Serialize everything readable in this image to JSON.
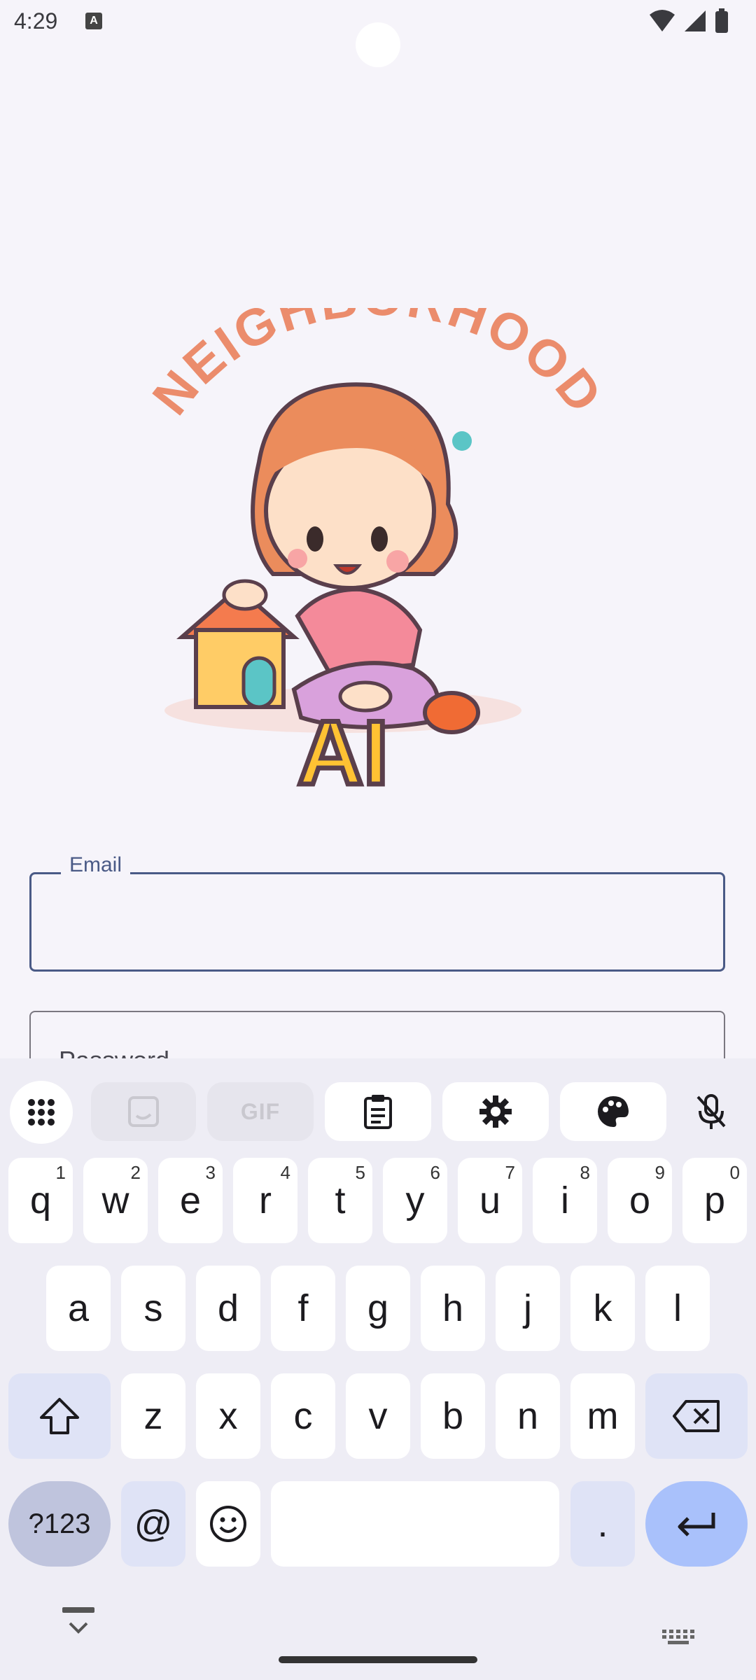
{
  "status_bar": {
    "time": "4:29",
    "notification_icon": "A"
  },
  "app": {
    "logo": {
      "arc_text": "NEIGHBORHOOD",
      "text_bottom": "AI"
    },
    "email": {
      "label": "Email",
      "value": ""
    },
    "password": {
      "label": "Password"
    }
  },
  "keyboard": {
    "toolbar": {
      "apps_icon": "grid-icon",
      "sticker_icon": "sticker-icon",
      "gif": "GIF",
      "clipboard_icon": "clipboard-icon",
      "settings_icon": "gear-icon",
      "theme_icon": "palette-icon",
      "voice_icon": "mic-off-icon"
    },
    "row1": [
      {
        "key": "q",
        "hint": "1"
      },
      {
        "key": "w",
        "hint": "2"
      },
      {
        "key": "e",
        "hint": "3"
      },
      {
        "key": "r",
        "hint": "4"
      },
      {
        "key": "t",
        "hint": "5"
      },
      {
        "key": "y",
        "hint": "6"
      },
      {
        "key": "u",
        "hint": "7"
      },
      {
        "key": "i",
        "hint": "8"
      },
      {
        "key": "o",
        "hint": "9"
      },
      {
        "key": "p",
        "hint": "0"
      }
    ],
    "row2": [
      "a",
      "s",
      "d",
      "f",
      "g",
      "h",
      "j",
      "k",
      "l"
    ],
    "row3": [
      "z",
      "x",
      "c",
      "v",
      "b",
      "n",
      "m"
    ],
    "symbols_key": "?123",
    "at_key": "@",
    "period_key": ".",
    "colors": {
      "background": "#eeedf5",
      "key": "#ffffff",
      "modifier": "#dfe3f6",
      "enter": "#a9c1fb",
      "symbols": "#bfc4dd"
    }
  }
}
